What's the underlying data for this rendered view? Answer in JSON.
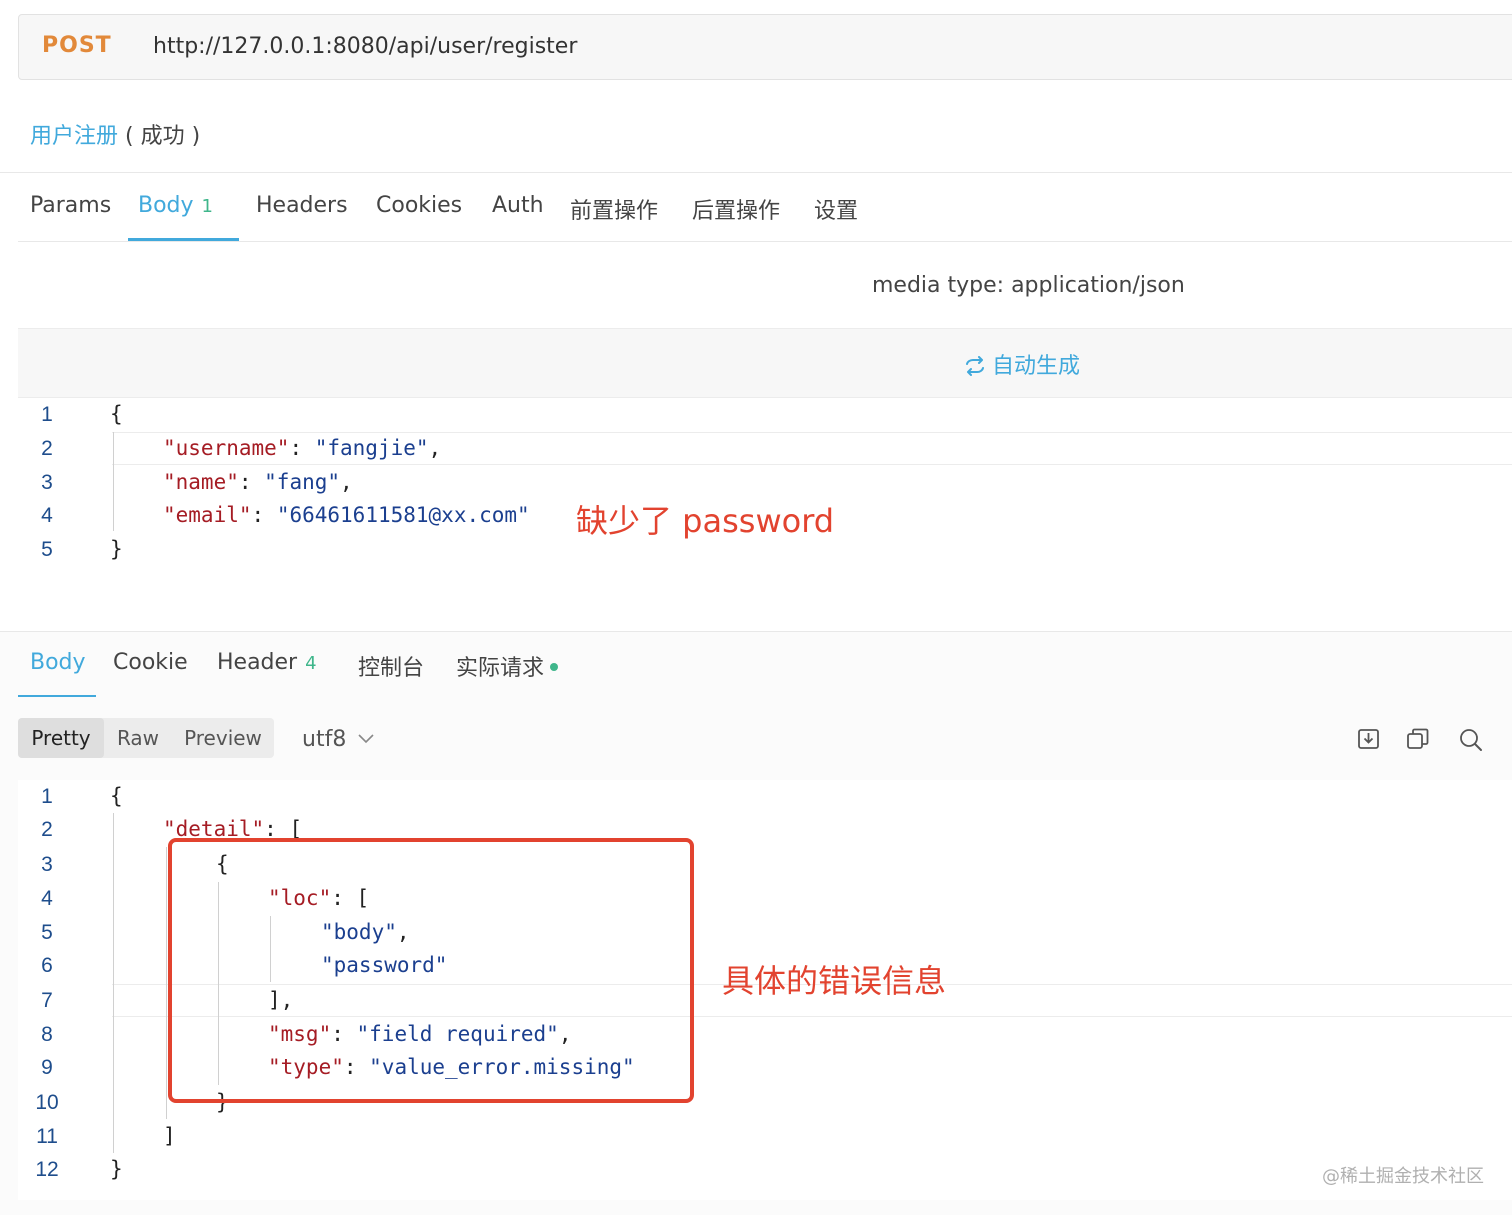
{
  "request": {
    "method": "POST",
    "url": "http://127.0.0.1:8080/api/user/register",
    "name": "用户注册",
    "status": "( 成功 )"
  },
  "request_tabs": [
    {
      "label": "Params",
      "count": ""
    },
    {
      "label": "Body",
      "count": "1"
    },
    {
      "label": "Headers",
      "count": ""
    },
    {
      "label": "Cookies",
      "count": ""
    },
    {
      "label": "Auth",
      "count": ""
    },
    {
      "label": "前置操作",
      "count": ""
    },
    {
      "label": "后置操作",
      "count": ""
    },
    {
      "label": "设置",
      "count": ""
    }
  ],
  "media_type": "media type: application/json",
  "autogen_label": "自动生成",
  "request_body": {
    "line_numbers": [
      "1",
      "2",
      "3",
      "4",
      "5"
    ],
    "l1": "{",
    "l2": {
      "key": "\"username\"",
      "colon": ": ",
      "val": "\"fangjie\"",
      "end": ","
    },
    "l3": {
      "key": "\"name\"",
      "colon": ": ",
      "val": "\"fang\"",
      "end": ","
    },
    "l4": {
      "key": "\"email\"",
      "colon": ": ",
      "val": "\"66461611581@xx.com\""
    },
    "l5": "}"
  },
  "annotation_missing": "缺少了 password",
  "response_tabs": [
    {
      "label": "Body",
      "count": ""
    },
    {
      "label": "Cookie",
      "count": ""
    },
    {
      "label": "Header",
      "count": "4"
    },
    {
      "label": "控制台",
      "count": ""
    },
    {
      "label": "实际请求",
      "count": ""
    }
  ],
  "view_modes": [
    "Pretty",
    "Raw",
    "Preview"
  ],
  "encoding": "utf8",
  "toolbar_icons": [
    "download-icon",
    "copy-icon",
    "search-icon"
  ],
  "response_body": {
    "line_numbers": [
      "1",
      "2",
      "3",
      "4",
      "5",
      "6",
      "7",
      "8",
      "9",
      "10",
      "11",
      "12"
    ],
    "l1": "{",
    "l2": {
      "key": "\"detail\"",
      "colon": ": ",
      "end": "["
    },
    "l3": "{",
    "l4": {
      "key": "\"loc\"",
      "colon": ": ",
      "end": "["
    },
    "l5": {
      "val": "\"body\"",
      "end": ","
    },
    "l6": {
      "val": "\"password\""
    },
    "l7": "],",
    "l8": {
      "key": "\"msg\"",
      "colon": ": ",
      "val": "\"field required\"",
      "end": ","
    },
    "l9": {
      "key": "\"type\"",
      "colon": ": ",
      "val": "\"value_error.missing\""
    },
    "l10": "}",
    "l11": "]",
    "l12": "}"
  },
  "annotation_error": "具体的错误信息",
  "watermark": "@稀土掘金技术社区",
  "colors": {
    "accent": "#41a9dc",
    "method": "#e2893a",
    "annotation": "#e2432f",
    "json_key": "#a51c24",
    "json_string": "#1b3f8f",
    "badge": "#3fb68b"
  }
}
